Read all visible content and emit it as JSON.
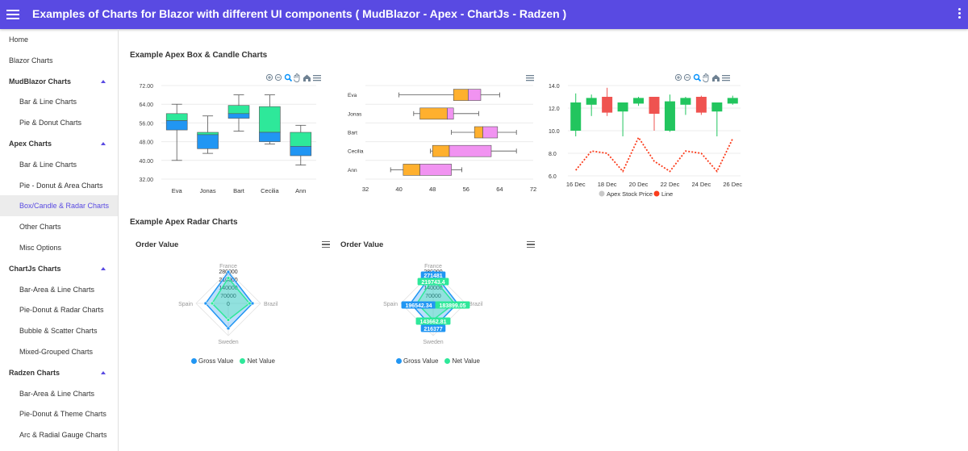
{
  "app": {
    "title": "Examples of Charts for Blazor with different UI components ( MudBlazor - Apex - ChartJs - Radzen )"
  },
  "colors": {
    "primary": "#594ae2",
    "teal": "#2ee89a",
    "blue": "#2196f3",
    "orange": "#ffb02e",
    "pink": "#f193f1",
    "green": "#22c55e",
    "red": "#ef5350",
    "line": "#fb3c1c"
  },
  "sidebar": {
    "items": [
      {
        "label": "Home",
        "kind": "top"
      },
      {
        "label": "Blazor Charts",
        "kind": "top"
      },
      {
        "label": "MudBlazor Charts",
        "kind": "group"
      },
      {
        "label": "Bar & Line Charts",
        "kind": "sub"
      },
      {
        "label": "Pie & Donut Charts",
        "kind": "sub"
      },
      {
        "label": "Apex Charts",
        "kind": "group"
      },
      {
        "label": "Bar & Line Charts",
        "kind": "sub"
      },
      {
        "label": "Pie - Donut & Area Charts",
        "kind": "sub"
      },
      {
        "label": "Box/Candle & Radar Charts",
        "kind": "sub",
        "active": true
      },
      {
        "label": "Other Charts",
        "kind": "sub"
      },
      {
        "label": "Misc Options",
        "kind": "sub"
      },
      {
        "label": "ChartJs Charts",
        "kind": "group"
      },
      {
        "label": "Bar-Area & Line Charts",
        "kind": "sub"
      },
      {
        "label": "Pie-Donut & Radar Charts",
        "kind": "sub"
      },
      {
        "label": "Bubble & Scatter Charts",
        "kind": "sub"
      },
      {
        "label": "Mixed-Grouped Charts",
        "kind": "sub"
      },
      {
        "label": "Radzen Charts",
        "kind": "group"
      },
      {
        "label": "Bar-Area & Line Charts",
        "kind": "sub"
      },
      {
        "label": "Pie-Donut & Theme Charts",
        "kind": "sub"
      },
      {
        "label": "Arc & Radial Gauge Charts",
        "kind": "sub"
      }
    ]
  },
  "main": {
    "section1_title": "Example Apex Box & Candle Charts",
    "section2_title": "Example Apex Radar Charts"
  },
  "chart_data": [
    {
      "type": "box",
      "orientation": "vertical",
      "categories": [
        "Eva",
        "Jonas",
        "Bart",
        "Cecilia",
        "Ann"
      ],
      "ylim": [
        32,
        72
      ],
      "yticks": [
        "72.00",
        "64.00",
        "56.00",
        "48.00",
        "40.00",
        "32.00"
      ],
      "boxes": [
        {
          "min": 40,
          "q1": 53,
          "median": 57,
          "q3": 60,
          "max": 64
        },
        {
          "min": 43,
          "q1": 45,
          "median": 51,
          "q3": 52,
          "max": 59
        },
        {
          "min": 52.5,
          "q1": 58,
          "median": 60,
          "q3": 63.5,
          "max": 68
        },
        {
          "min": 47,
          "q1": 48,
          "median": 52,
          "q3": 63,
          "max": 68
        },
        {
          "min": 38,
          "q1": 42,
          "median": 46,
          "q3": 52,
          "max": 55
        }
      ],
      "colors": {
        "upper": "#2ee89a",
        "lower": "#2196f3"
      }
    },
    {
      "type": "box",
      "orientation": "horizontal",
      "categories": [
        "Eva",
        "Jonas",
        "Bart",
        "Cecilia",
        "Ann"
      ],
      "xlim": [
        32,
        72
      ],
      "xticks": [
        "32",
        "40",
        "48",
        "56",
        "64",
        "72"
      ],
      "boxes": [
        {
          "min": 40,
          "q1": 53,
          "median": 56.5,
          "q3": 59.5,
          "max": 64
        },
        {
          "min": 43.5,
          "q1": 45,
          "median": 51.5,
          "q3": 53,
          "max": 59
        },
        {
          "min": 52.5,
          "q1": 58,
          "median": 60,
          "q3": 63.5,
          "max": 68
        },
        {
          "min": 47.5,
          "q1": 48,
          "median": 52,
          "q3": 62,
          "max": 68
        },
        {
          "min": 38,
          "q1": 41,
          "median": 45,
          "q3": 52.5,
          "max": 55
        }
      ],
      "colors": {
        "left": "#ffb02e",
        "right": "#f193f1"
      }
    },
    {
      "type": "candlestick",
      "ylim": [
        6,
        14
      ],
      "yticks": [
        "14.0",
        "12.0",
        "10.0",
        "8.0",
        "6.0"
      ],
      "xticks": [
        "16 Dec",
        "18 Dec",
        "20 Dec",
        "22 Dec",
        "24 Dec",
        "26 Dec"
      ],
      "candles": [
        {
          "open": 10,
          "high": 13.3,
          "low": 9.5,
          "close": 12.5
        },
        {
          "open": 12.3,
          "high": 13.2,
          "low": 11.3,
          "close": 12.9
        },
        {
          "open": 13,
          "high": 13.8,
          "low": 11.3,
          "close": 11.6
        },
        {
          "open": 11.7,
          "high": 12.5,
          "low": 9.5,
          "close": 12.5
        },
        {
          "open": 12.4,
          "high": 13.0,
          "low": 12.2,
          "close": 12.9
        },
        {
          "open": 13,
          "high": 13.0,
          "low": 10.0,
          "close": 11.5
        },
        {
          "open": 10,
          "high": 13.2,
          "low": 9.9,
          "close": 12.6
        },
        {
          "open": 12.3,
          "high": 13.0,
          "low": 11.4,
          "close": 12.9
        },
        {
          "open": 13,
          "high": 13.1,
          "low": 11.4,
          "close": 11.6
        },
        {
          "open": 11.7,
          "high": 12.5,
          "low": 9.5,
          "close": 12.5
        },
        {
          "open": 12.4,
          "high": 13.1,
          "low": 12.3,
          "close": 12.9
        }
      ],
      "line": [
        6.5,
        8.2,
        8.0,
        6.4,
        9.4,
        7.3,
        6.4,
        8.2,
        8.0,
        6.4,
        9.3
      ],
      "legend": [
        {
          "name": "Apex Stock Price",
          "color": "#c8c8c8"
        },
        {
          "name": "Line",
          "color": "#fb3c1c"
        }
      ]
    },
    {
      "type": "radar",
      "title": "Order Value",
      "axes": [
        "France",
        "Brazil",
        "Sweden",
        "Spain"
      ],
      "ticks": [
        "280000",
        "210000",
        "140000",
        "70000",
        "0"
      ],
      "series": [
        {
          "name": "Gross Value",
          "color": "#2196f3",
          "values": [
            271481,
            210000,
            216377,
            196542
          ]
        },
        {
          "name": "Net Value",
          "color": "#2ee89a",
          "values": [
            219743.4,
            183899.05,
            143662.81,
            140000
          ]
        }
      ],
      "show_data_labels": false
    },
    {
      "type": "radar",
      "title": "Order Value",
      "axes": [
        "France",
        "Brazil",
        "Sweden",
        "Spain"
      ],
      "ticks": [
        "280000",
        "210000",
        "140000",
        "70000",
        "0"
      ],
      "series": [
        {
          "name": "Gross Value",
          "color": "#2196f3",
          "values": [
            271481,
            210000,
            216377,
            196542.34
          ]
        },
        {
          "name": "Net Value",
          "color": "#2ee89a",
          "values": [
            219743.4,
            183899.05,
            143662.81,
            140000
          ]
        }
      ],
      "data_labels": [
        {
          "text": "271481",
          "series": 0,
          "axis": 0
        },
        {
          "text": "219743.4",
          "series": 1,
          "axis": 0
        },
        {
          "text": "196542.34",
          "series": 0,
          "axis": 3
        },
        {
          "text": "183899.05",
          "series": 1,
          "axis": 1
        },
        {
          "text": "143662.81",
          "series": 1,
          "axis": 2
        },
        {
          "text": "216377",
          "series": 0,
          "axis": 2
        }
      ],
      "show_data_labels": true
    }
  ]
}
